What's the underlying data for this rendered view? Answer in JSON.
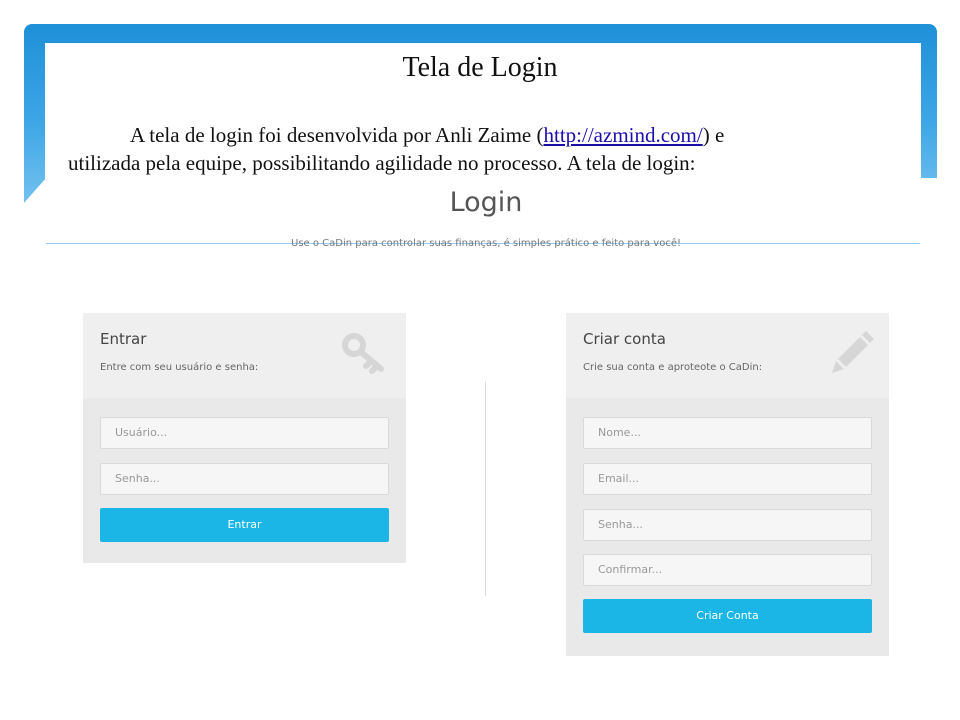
{
  "slide": {
    "title": "Tela de Login",
    "paragraph": {
      "line1_before": "A tela de login foi desenvolvida por Anli Zaime (",
      "link": "http://azmind.com/",
      "line1_after": ") e",
      "line2": "utilizada pela equipe, possibilitando agilidade no processo. A tela de login:"
    }
  },
  "login_screen": {
    "heading": "Login",
    "subtitle": "Use o CaDin para controlar suas finanças, é simples prático e feito para você!",
    "signin": {
      "title": "Entrar",
      "description": "Entre com seu usuário e senha:",
      "icon": "key-icon",
      "username_placeholder": "Usuário...",
      "password_placeholder": "Senha...",
      "button_label": "Entrar"
    },
    "signup": {
      "title": "Criar conta",
      "description": "Crie sua conta e aproteote o CaDin:",
      "icon": "pencil-icon",
      "name_placeholder": "Nome...",
      "email_placeholder": "Email...",
      "password_placeholder": "Senha...",
      "confirm_placeholder": "Confirmar...",
      "button_label": "Criar Conta"
    }
  },
  "colors": {
    "slide_accent": "#1e90d8",
    "button": "#1cb6e6",
    "panel": "#f0f0f0"
  }
}
